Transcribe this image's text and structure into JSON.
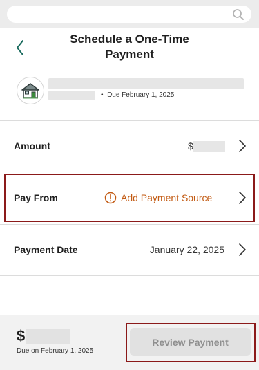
{
  "search": {
    "placeholder": ""
  },
  "header": {
    "title_line1": "Schedule a One-Time",
    "title_line2": "Payment"
  },
  "account": {
    "due_text": "Due February 1, 2025"
  },
  "rows": {
    "amount": {
      "label": "Amount",
      "currency": "$"
    },
    "pay_from": {
      "label": "Pay From",
      "value": "Add Payment Source"
    },
    "payment_date": {
      "label": "Payment Date",
      "value": "January 22, 2025"
    }
  },
  "footer": {
    "currency": "$",
    "due_text": "Due on February 1, 2025",
    "review_label": "Review Payment",
    "review_enabled": false
  },
  "colors": {
    "accent_teal": "#1a6b5e",
    "warning_orange": "#c25a12",
    "highlight_frame": "#8b1a1a",
    "disabled_button": "#e1e1e1"
  },
  "icons": {
    "search": "search-icon",
    "back": "chevron-left-icon",
    "house": "house-icon",
    "row_arrow": "chevron-right-icon",
    "warning": "alert-circle-icon"
  }
}
